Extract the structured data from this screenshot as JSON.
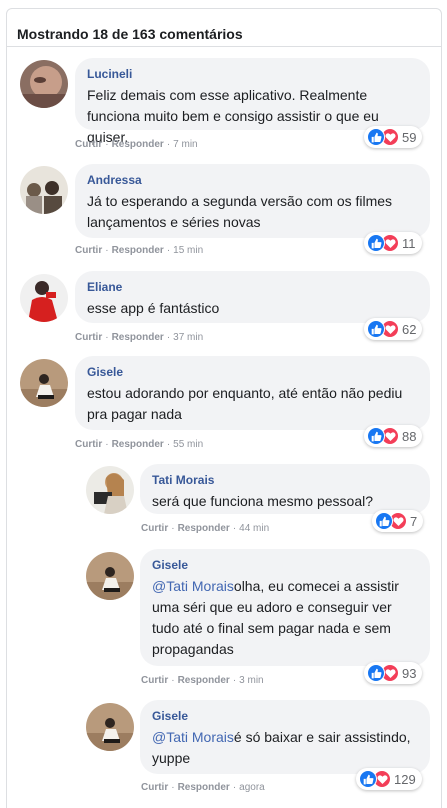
{
  "header": {
    "title": "Mostrando 18 de 163 comentários"
  },
  "labels": {
    "like": "Curtir",
    "reply": "Responder",
    "sep": "·"
  },
  "comments": [
    {
      "author": "Lucineli",
      "text": "Feliz demais com esse aplicativo. Realmente funciona muito bem e consigo assistir o que eu quiser.",
      "time": "7 min",
      "reactions": "59"
    },
    {
      "author": "Andressa",
      "text": "Já to esperando a segunda versão com os filmes lançamentos e séries novas",
      "time": "15 min",
      "reactions": "11"
    },
    {
      "author": "Eliane",
      "text": "esse app é fantástico",
      "time": "37 min",
      "reactions": "62"
    },
    {
      "author": "Gisele",
      "text": "estou adorando por enquanto, até então não pediu pra pagar nada",
      "time": "55 min",
      "reactions": "88"
    }
  ],
  "replies": [
    {
      "author": "Tati Morais",
      "text": "será que funciona mesmo pessoal?",
      "time": "44 min",
      "reactions": "7"
    },
    {
      "author": "Gisele",
      "mention": "@Tati Morais",
      "text": "olha, eu comecei a assistir uma séri que eu adoro e conseguir ver tudo até o final sem pagar nada e sem propagandas",
      "time": "3 min",
      "reactions": "93"
    },
    {
      "author": "Gisele",
      "mention": "@Tati Morais",
      "text": "é só baixar e sair assistindo, yuppe",
      "time": "agora",
      "reactions": "129"
    }
  ],
  "colors": {
    "author": "#385898",
    "mention": "#4267b2",
    "like": "#1877f2",
    "love": "#f33e58",
    "bubble": "#f2f3f5"
  },
  "icons": {
    "like": "thumbs-up-icon",
    "love": "heart-icon"
  }
}
